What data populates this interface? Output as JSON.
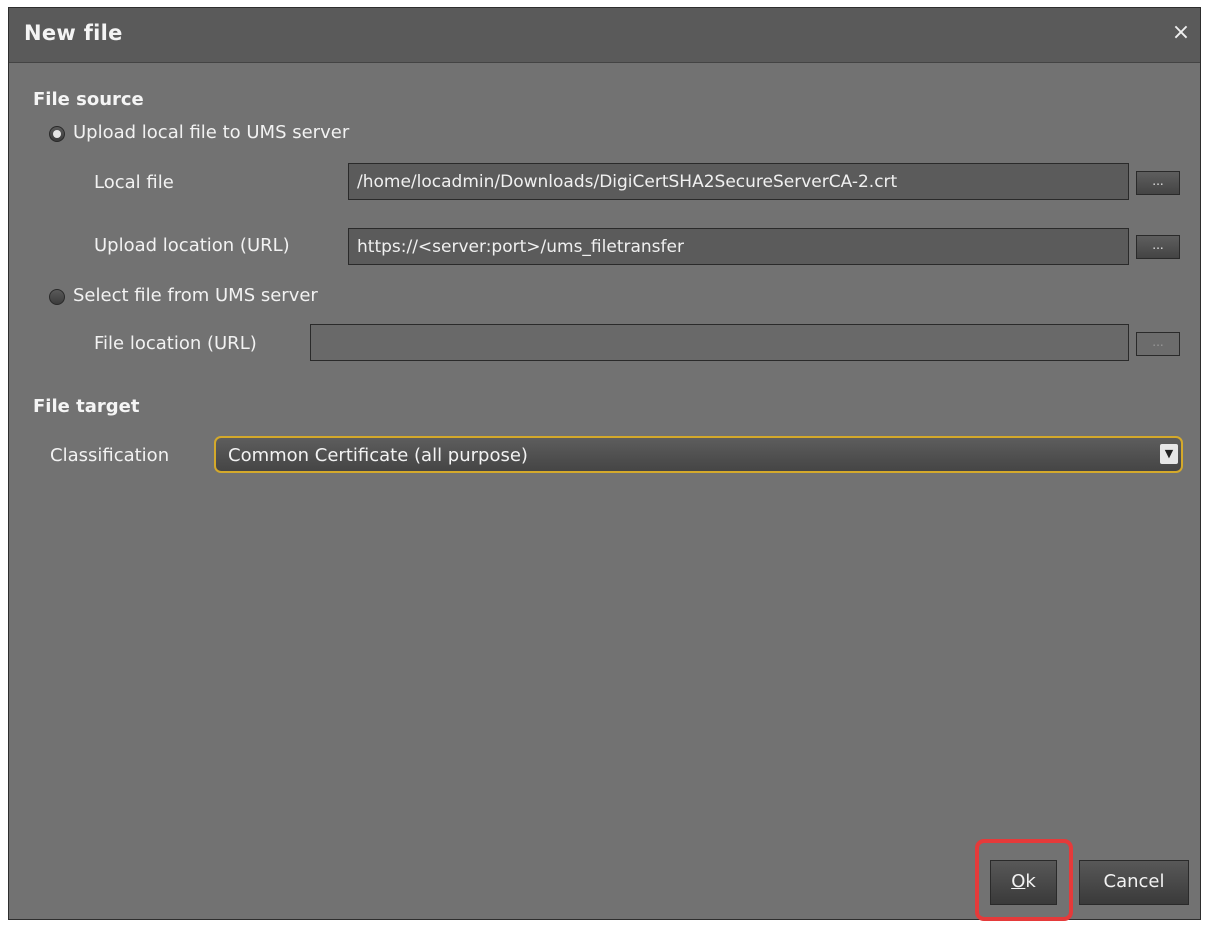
{
  "dialog": {
    "title": "New file",
    "close_glyph": "×"
  },
  "file_source": {
    "heading": "File source",
    "upload_option": {
      "label": "Upload local file to UMS server",
      "selected": true
    },
    "local_file": {
      "label": "Local file",
      "value": "/home/locadmin/Downloads/DigiCertSHA2SecureServerCA-2.crt",
      "browse_label": "..."
    },
    "upload_location": {
      "label": "Upload location (URL)",
      "value": "https://<server:port>/ums_filetransfer",
      "browse_label": "..."
    },
    "select_option": {
      "label": "Select file from UMS server",
      "selected": false
    },
    "file_location": {
      "label": "File location (URL)",
      "value": "",
      "browse_label": "..."
    }
  },
  "file_target": {
    "heading": "File target",
    "classification": {
      "label": "Classification",
      "selected": "Common Certificate (all purpose)"
    }
  },
  "buttons": {
    "ok_mnemonic": "O",
    "ok_rest": "k",
    "cancel": "Cancel"
  },
  "colors": {
    "dialog_bg": "#727272",
    "titlebar_bg": "#5a5a5a",
    "focus_border": "#d4a92b",
    "highlight": "#e53a3a"
  },
  "icons": {
    "close": "close-icon",
    "dropdown": "chevron-down-icon"
  }
}
